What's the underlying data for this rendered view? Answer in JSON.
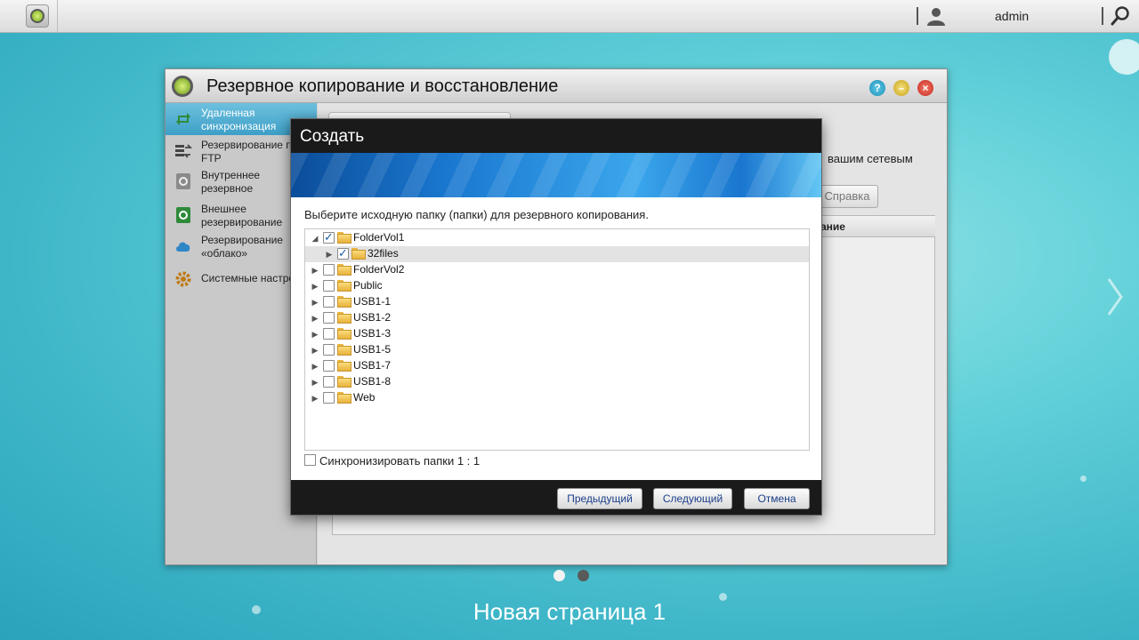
{
  "topbar": {
    "username": "admin"
  },
  "window": {
    "title": "Резервное копирование и восстановление",
    "help_glyph": "?"
  },
  "sidebar": {
    "items": [
      {
        "label": "Удаленная\nсинхронизация",
        "icon": "sync-icon",
        "active": true
      },
      {
        "label": "Резервирование по\nFTP",
        "icon": "ftp-icon",
        "active": false
      },
      {
        "label": "Внутреннее\nрезервное",
        "icon": "internal-backup-icon",
        "active": false
      },
      {
        "label": "Внешнее\nрезервирование",
        "icon": "external-backup-icon",
        "active": false
      },
      {
        "label": "Резервирование\n«облако»",
        "icon": "cloud-icon",
        "active": false
      },
      {
        "label": "Системные настройки",
        "icon": "gear-icon",
        "active": false
      }
    ]
  },
  "background": {
    "tab_label": "Удаленная синхронизация",
    "partial_text": "вашим сетевым",
    "help_button": "Справка",
    "grid_header_partial": "ание"
  },
  "dialog": {
    "title": "Создать",
    "instruction": "Выберите исходную папку (папки) для резервного копирования.",
    "tree": [
      {
        "label": "FolderVol1",
        "checked": true,
        "level": 0,
        "expanded": true
      },
      {
        "label": "32files",
        "checked": true,
        "level": 1,
        "expanded": false,
        "selected": true
      },
      {
        "label": "FolderVol2",
        "checked": false,
        "level": 0,
        "expanded": false
      },
      {
        "label": "Public",
        "checked": false,
        "level": 0,
        "expanded": false
      },
      {
        "label": "USB1-1",
        "checked": false,
        "level": 0,
        "expanded": false
      },
      {
        "label": "USB1-2",
        "checked": false,
        "level": 0,
        "expanded": false
      },
      {
        "label": "USB1-3",
        "checked": false,
        "level": 0,
        "expanded": false
      },
      {
        "label": "USB1-5",
        "checked": false,
        "level": 0,
        "expanded": false
      },
      {
        "label": "USB1-7",
        "checked": false,
        "level": 0,
        "expanded": false
      },
      {
        "label": "USB1-8",
        "checked": false,
        "level": 0,
        "expanded": false
      },
      {
        "label": "Web",
        "checked": false,
        "level": 0,
        "expanded": false
      }
    ],
    "sync_label": "Синхронизировать папки 1 : 1",
    "sync_checked": false,
    "buttons": {
      "prev": "Предыдущий",
      "next": "Следующий",
      "cancel": "Отмена"
    }
  },
  "pager": {
    "caption": "Новая страница 1",
    "current": 1,
    "total": 2
  },
  "colors": {
    "accent": "#3d9fc7",
    "dialog_chrome": "#1a1a1a",
    "button_text": "#1c3f8a"
  }
}
